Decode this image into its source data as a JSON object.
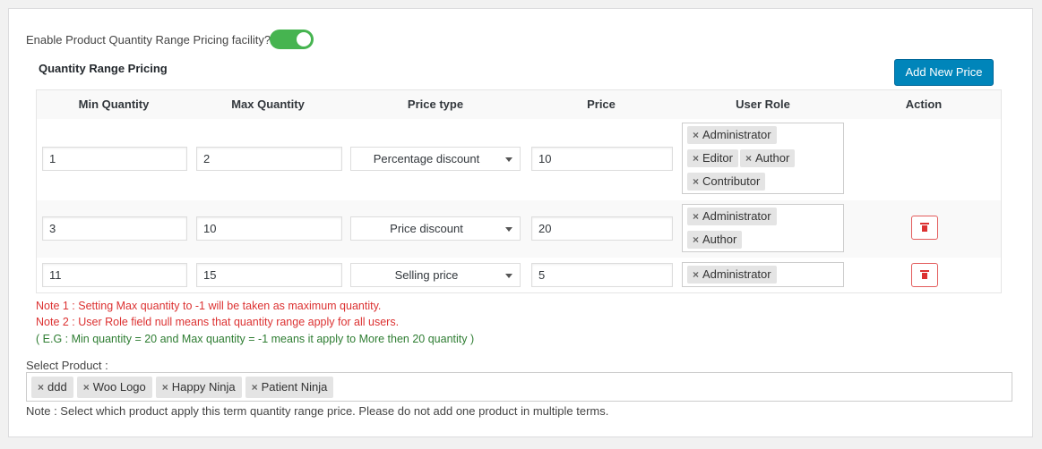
{
  "settings": {
    "enable_label": "Enable Product Quantity Range Pricing facility?",
    "enabled": true,
    "toggle_color": "#46b450"
  },
  "pricing": {
    "section_title": "Quantity Range Pricing",
    "add_button": "Add New Price",
    "columns": [
      "Min Quantity",
      "Max Quantity",
      "Price type",
      "Price",
      "User Role",
      "Action"
    ],
    "rows": [
      {
        "min": "1",
        "max": "2",
        "price_type": "Percentage discount",
        "price": "10",
        "roles": [
          "Administrator",
          "Editor",
          "Author",
          "Contributor"
        ]
      },
      {
        "min": "3",
        "max": "10",
        "price_type": "Price discount",
        "price": "20",
        "roles": [
          "Administrator",
          "Author"
        ]
      },
      {
        "min": "11",
        "max": "15",
        "price_type": "Selling price",
        "price": "5",
        "roles": [
          "Administrator"
        ]
      }
    ],
    "remove_glyph": "×",
    "delete_icon": "trash-icon",
    "delete_color": "#dc3232"
  },
  "notes": {
    "note1": "Note 1 : Setting Max quantity to -1 will be taken as maximum quantity.",
    "note2": "Note 2 : User Role field null means that quantity range apply for all users.",
    "note3": "( E.G : Min quantity = 20 and Max quantity = -1 means it apply to More then 20 quantity )",
    "note_color_red": "#dc3232",
    "note_color_green": "#2e7d32"
  },
  "products": {
    "label": "Select Product :",
    "selected": [
      "ddd",
      "Woo Logo",
      "Happy Ninja",
      "Patient Ninja"
    ],
    "footnote": "Note : Select which product apply this term quantity range price. Please do not add one product in multiple terms."
  },
  "colors": {
    "primary_button": "#0085ba"
  }
}
